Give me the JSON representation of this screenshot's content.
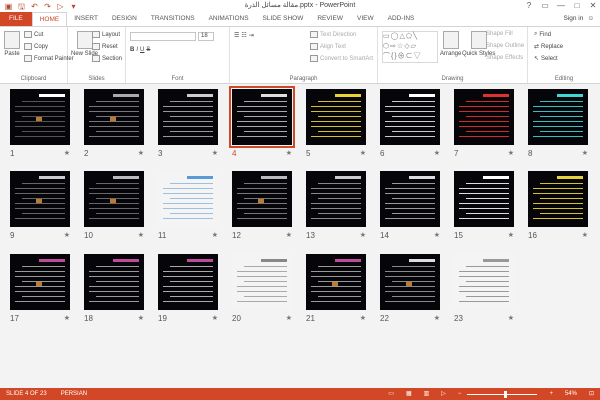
{
  "window": {
    "title": "مقالة مسائل الذرة.pptx - PowerPoint",
    "controls": [
      "?",
      "▭",
      "—",
      "□",
      "✕"
    ]
  },
  "qat": [
    "save-icon",
    "undo-icon",
    "redo-icon",
    "slideshow-icon",
    "customize-icon"
  ],
  "tabs": [
    {
      "label": "FILE",
      "kind": "file"
    },
    {
      "label": "HOME",
      "kind": "active"
    },
    {
      "label": "INSERT",
      "kind": ""
    },
    {
      "label": "DESIGN",
      "kind": ""
    },
    {
      "label": "TRANSITIONS",
      "kind": ""
    },
    {
      "label": "ANIMATIONS",
      "kind": ""
    },
    {
      "label": "SLIDE SHOW",
      "kind": ""
    },
    {
      "label": "REVIEW",
      "kind": ""
    },
    {
      "label": "VIEW",
      "kind": ""
    },
    {
      "label": "ADD-INS",
      "kind": ""
    }
  ],
  "signin": "Sign in",
  "ribbon": {
    "clipboard": {
      "label": "Clipboard",
      "paste": "Paste",
      "cut": "Cut",
      "copy": "Copy",
      "format_painter": "Format Painter"
    },
    "slides": {
      "label": "Slides",
      "new_slide": "New Slide",
      "layout": "Layout",
      "reset": "Reset",
      "section": "Section"
    },
    "font": {
      "label": "Font",
      "size": "18"
    },
    "paragraph": {
      "label": "Paragraph",
      "text_direction": "Text Direction",
      "align_text": "Align Text",
      "convert": "Convert to SmartArt"
    },
    "drawing": {
      "label": "Drawing",
      "arrange": "Arrange",
      "quick_styles": "Quick Styles",
      "shape_fill": "Shape Fill",
      "shape_outline": "Shape Outline",
      "shape_effects": "Shape Effects"
    },
    "editing": {
      "label": "Editing",
      "find": "Find",
      "replace": "Replace",
      "select": "Select"
    }
  },
  "slides": [
    {
      "num": "1",
      "title_color": "#ffffff",
      "text_color": "#555555",
      "dot": true,
      "selected": false,
      "light": false
    },
    {
      "num": "2",
      "title_color": "#aaaaaa",
      "text_color": "#777777",
      "dot": true,
      "selected": false,
      "light": false
    },
    {
      "num": "3",
      "title_color": "#cccccc",
      "text_color": "#999999",
      "dot": false,
      "selected": false,
      "light": false
    },
    {
      "num": "4",
      "title_color": "#dddddd",
      "text_color": "#aaaaaa",
      "dot": false,
      "selected": true,
      "light": false
    },
    {
      "num": "5",
      "title_color": "#e8d23a",
      "text_color": "#d6c12b",
      "dot": false,
      "selected": false,
      "light": false
    },
    {
      "num": "6",
      "title_color": "#ffffff",
      "text_color": "#cccccc",
      "dot": false,
      "selected": false,
      "light": false
    },
    {
      "num": "7",
      "title_color": "#e03030",
      "text_color": "#d12a2a",
      "dot": false,
      "selected": false,
      "light": false
    },
    {
      "num": "8",
      "title_color": "#40d6d6",
      "text_color": "#38c0c0",
      "dot": false,
      "selected": false,
      "light": false
    },
    {
      "num": "9",
      "title_color": "#cccccc",
      "text_color": "#666666",
      "dot": true,
      "selected": false,
      "light": false
    },
    {
      "num": "10",
      "title_color": "#bbbbbb",
      "text_color": "#666666",
      "dot": true,
      "selected": false,
      "light": false
    },
    {
      "num": "11",
      "title_color": "#5b9bd5",
      "text_color": "#9ec0de",
      "dot": false,
      "selected": false,
      "light": true
    },
    {
      "num": "12",
      "title_color": "#bbbbbb",
      "text_color": "#777777",
      "dot": true,
      "selected": false,
      "light": false
    },
    {
      "num": "13",
      "title_color": "#cccccc",
      "text_color": "#888888",
      "dot": false,
      "selected": false,
      "light": false
    },
    {
      "num": "14",
      "title_color": "#dddddd",
      "text_color": "#999999",
      "dot": false,
      "selected": false,
      "light": false
    },
    {
      "num": "15",
      "title_color": "#ffffff",
      "text_color": "#dddddd",
      "dot": false,
      "selected": false,
      "light": false
    },
    {
      "num": "16",
      "title_color": "#e8d23a",
      "text_color": "#d6c12b",
      "dot": false,
      "selected": false,
      "light": false
    },
    {
      "num": "17",
      "title_color": "#c0499b",
      "text_color": "#999999",
      "dot": true,
      "selected": false,
      "light": false
    },
    {
      "num": "18",
      "title_color": "#c0499b",
      "text_color": "#999999",
      "dot": false,
      "selected": false,
      "light": false
    },
    {
      "num": "19",
      "title_color": "#c0499b",
      "text_color": "#aaaaaa",
      "dot": false,
      "selected": false,
      "light": false
    },
    {
      "num": "20",
      "title_color": "#888888",
      "text_color": "#aaaaaa",
      "dot": false,
      "selected": false,
      "light": true
    },
    {
      "num": "21",
      "title_color": "#c0499b",
      "text_color": "#999999",
      "dot": true,
      "selected": false,
      "light": false
    },
    {
      "num": "22",
      "title_color": "#dddddd",
      "text_color": "#888888",
      "dot": true,
      "selected": false,
      "light": false
    },
    {
      "num": "23",
      "title_color": "#999999",
      "text_color": "#999999",
      "dot": false,
      "selected": false,
      "light": true
    }
  ],
  "status": {
    "slide": "SLIDE 4 OF 23",
    "lang": "PERSIAN",
    "zoom": "54%",
    "zoom_level": 0.54
  }
}
